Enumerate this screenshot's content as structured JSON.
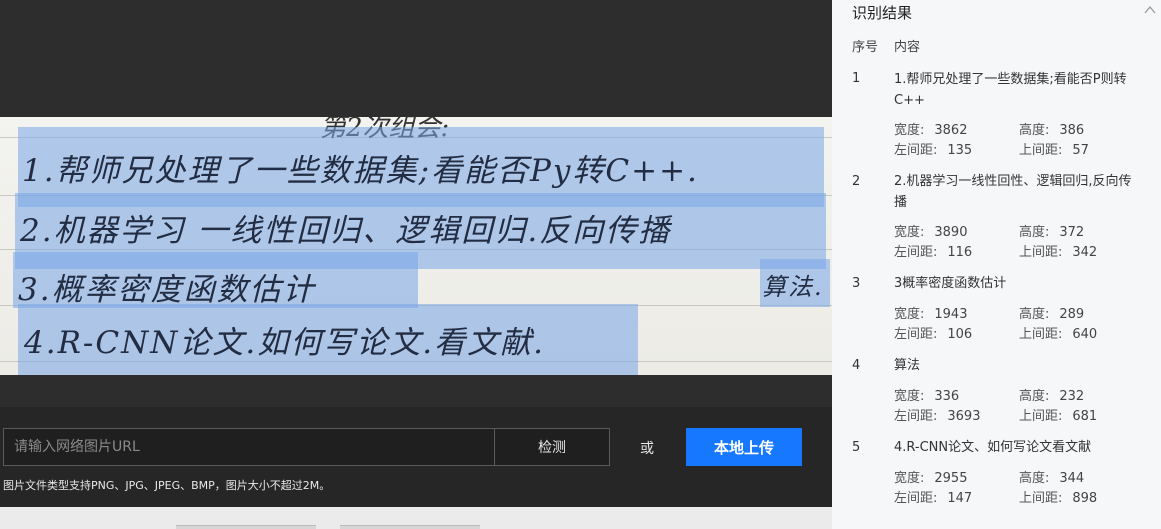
{
  "upload": {
    "url_placeholder": "请输入网络图片URL",
    "detect_label": "检测",
    "or_label": "或",
    "local_upload_label": "本地上传",
    "hint": "图片文件类型支持PNG、JPG、JPEG、BMP，图片大小不超过2M。"
  },
  "image": {
    "header_fragment": "第2次组会:",
    "lines": [
      "1.帮师兄处理了一些数据集;看能否Py转C++.",
      "2.机器学习 一线性回归、逻辑回归.反向传播",
      "3.概率密度函数估计",
      "算法.",
      "4.R-CNN论文.如何写论文.看文献."
    ]
  },
  "results": {
    "title": "识别结果",
    "col_index": "序号",
    "col_content": "内容",
    "labels": {
      "width": "宽度:",
      "height": "高度:",
      "left": "左间距:",
      "top": "上间距:"
    },
    "items": [
      {
        "index": "1",
        "text": "1.帮师兄处理了一些数据集;看能否P则转C++",
        "width": "3862",
        "height": "386",
        "left": "135",
        "top": "57"
      },
      {
        "index": "2",
        "text": "2.机器学习一线性回性、逻辑回归,反向传播",
        "width": "3890",
        "height": "372",
        "left": "116",
        "top": "342"
      },
      {
        "index": "3",
        "text": "3概率密度函数估计",
        "width": "1943",
        "height": "289",
        "left": "106",
        "top": "640"
      },
      {
        "index": "4",
        "text": "算法",
        "width": "336",
        "height": "232",
        "left": "3693",
        "top": "681"
      },
      {
        "index": "5",
        "text": "4.R-CNN论文、如何写论文看文献",
        "width": "2955",
        "height": "344",
        "left": "147",
        "top": "898"
      }
    ]
  },
  "colors": {
    "accent": "#1677ff",
    "highlight": "#78a5e6"
  }
}
